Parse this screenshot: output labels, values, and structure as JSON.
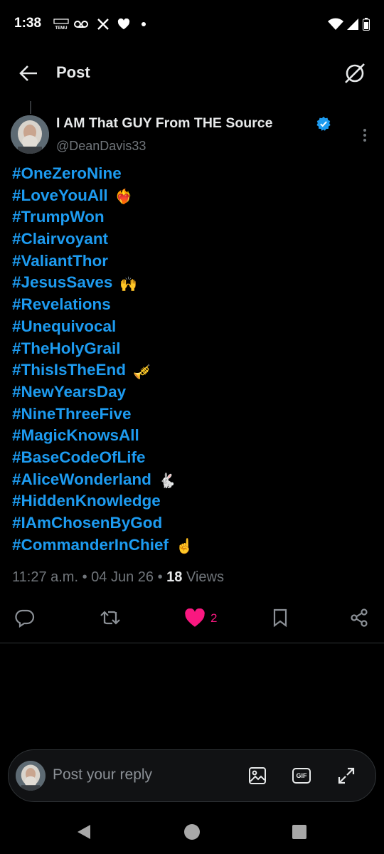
{
  "status_bar": {
    "time": "1:38"
  },
  "header": {
    "title": "Post"
  },
  "author": {
    "name": "I AM That GUY From THE Source",
    "handle": "@DeanDavis33"
  },
  "tweet": {
    "lines": [
      {
        "text": "#OneZeroNine",
        "emoji": ""
      },
      {
        "text": "#LoveYouAll",
        "emoji": "❤️‍🔥"
      },
      {
        "text": "#TrumpWon",
        "emoji": ""
      },
      {
        "text": "#Clairvoyant",
        "emoji": ""
      },
      {
        "text": "#ValiantThor",
        "emoji": ""
      },
      {
        "text": "#JesusSaves",
        "emoji": "🙌"
      },
      {
        "text": "#Revelations",
        "emoji": ""
      },
      {
        "text": "#Unequivocal",
        "emoji": ""
      },
      {
        "text": "#TheHolyGrail",
        "emoji": ""
      },
      {
        "text": "#ThisIsTheEnd",
        "emoji": "🎺"
      },
      {
        "text": "#NewYearsDay",
        "emoji": ""
      },
      {
        "text": "#NineThreeFive",
        "emoji": ""
      },
      {
        "text": "#MagicKnowsAll",
        "emoji": ""
      },
      {
        "text": "#BaseCodeOfLife",
        "emoji": ""
      },
      {
        "text": "#AliceWonderland",
        "emoji": "🐇"
      },
      {
        "text": "#HiddenKnowledge",
        "emoji": ""
      },
      {
        "text": "#IAmChosenByGod",
        "emoji": ""
      },
      {
        "text": "#CommanderInChief",
        "emoji": "☝️"
      }
    ],
    "time": "11:27 a.m.",
    "sep": "•",
    "date": "04 Jun 26",
    "views_count": "18",
    "views_label": "Views"
  },
  "actions": {
    "like_count": "2"
  },
  "reply": {
    "placeholder": "Post your reply",
    "gif_label": "GIF"
  },
  "colors": {
    "accent": "#1d9bf0",
    "like": "#f91880",
    "muted": "#71767b"
  }
}
